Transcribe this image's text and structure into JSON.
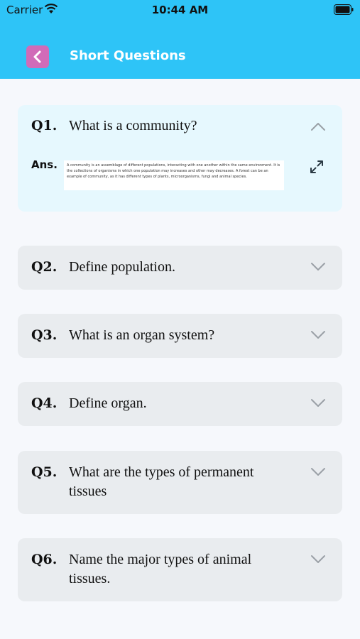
{
  "status_bar": {
    "carrier": "Carrier",
    "time": "10:44 AM"
  },
  "header": {
    "title": "Short Questions"
  },
  "questions": [
    {
      "number": "Q1.",
      "text": "What is a community?",
      "expanded": true,
      "answer_label": "Ans.",
      "answer": "A community is an assemblage of different populations, interacting with one another within the same environment. It is the collections of organisms in which one population may increases and other may decreases. A forest can be an example of community, as it has different types of plants, microorganisms, fungi and animal species."
    },
    {
      "number": "Q2.",
      "text": "Define population.",
      "expanded": false
    },
    {
      "number": "Q3.",
      "text": "What is an organ system?",
      "expanded": false
    },
    {
      "number": "Q4.",
      "text": "Define organ.",
      "expanded": false
    },
    {
      "number": "Q5.",
      "text": "What are the types of permanent tissues",
      "expanded": false
    },
    {
      "number": "Q6.",
      "text": "Name the major types of animal tissues.",
      "expanded": false
    }
  ],
  "colors": {
    "header_bg": "#2ec4f7",
    "back_button_bg": "#d16bb8",
    "expanded_card_bg": "#e6f8fe",
    "card_bg": "#e9ecef"
  }
}
